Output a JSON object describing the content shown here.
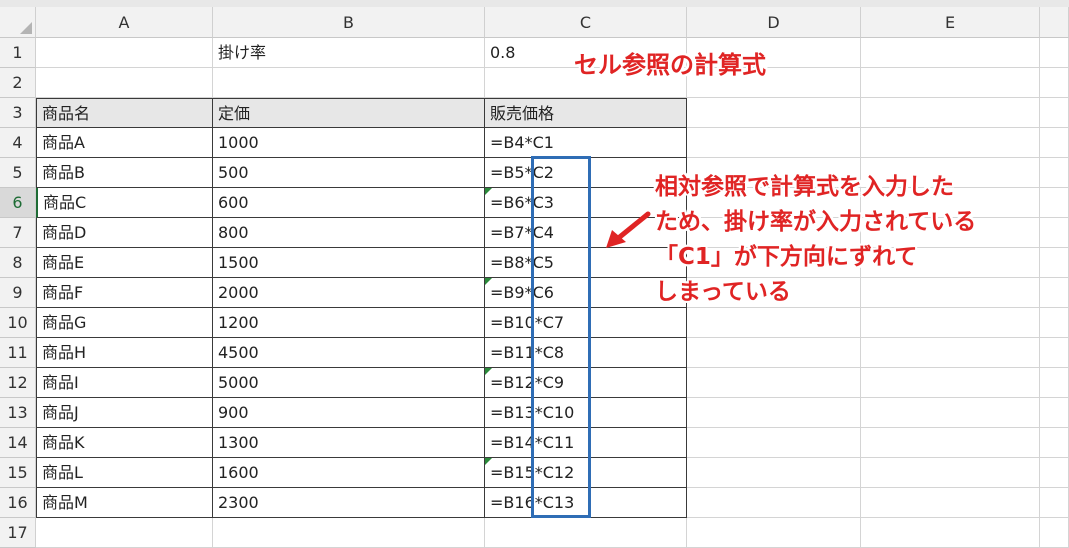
{
  "sheet": {
    "columns": [
      "A",
      "B",
      "C",
      "D",
      "E"
    ],
    "rows": [
      "1",
      "2",
      "3",
      "4",
      "5",
      "6",
      "7",
      "8",
      "9",
      "10",
      "11",
      "12",
      "13",
      "14",
      "15",
      "16",
      "17"
    ],
    "b1": "掛け率",
    "c1": "0.8",
    "headers": [
      "商品名",
      "定価",
      "販売価格"
    ],
    "data": [
      [
        "商品A",
        "1000",
        "=B4*C1"
      ],
      [
        "商品B",
        "500",
        "=B5*C2"
      ],
      [
        "商品C",
        "600",
        "=B6*C3"
      ],
      [
        "商品D",
        "800",
        "=B7*C4"
      ],
      [
        "商品E",
        "1500",
        "=B8*C5"
      ],
      [
        "商品F",
        "2000",
        "=B9*C6"
      ],
      [
        "商品G",
        "1200",
        "=B10*C7"
      ],
      [
        "商品H",
        "4500",
        "=B11*C8"
      ],
      [
        "商品I",
        "5000",
        "=B12*C9"
      ],
      [
        "商品J",
        "900",
        "=B13*C10"
      ],
      [
        "商品K",
        "1300",
        "=B14*C11"
      ],
      [
        "商品L",
        "1600",
        "=B15*C12"
      ],
      [
        "商品M",
        "2300",
        "=B16*C13"
      ]
    ]
  },
  "annotation": {
    "title": "セル参照の計算式",
    "note": [
      "相対参照で計算式を入力した",
      "ため、掛け率が入力されている",
      "「C1」が下方向にずれて",
      "しまっている"
    ]
  },
  "colors": {
    "annotation_red": "#e02424",
    "highlight_box": "#2f6db5",
    "error_marker": "#2a8a3a"
  }
}
